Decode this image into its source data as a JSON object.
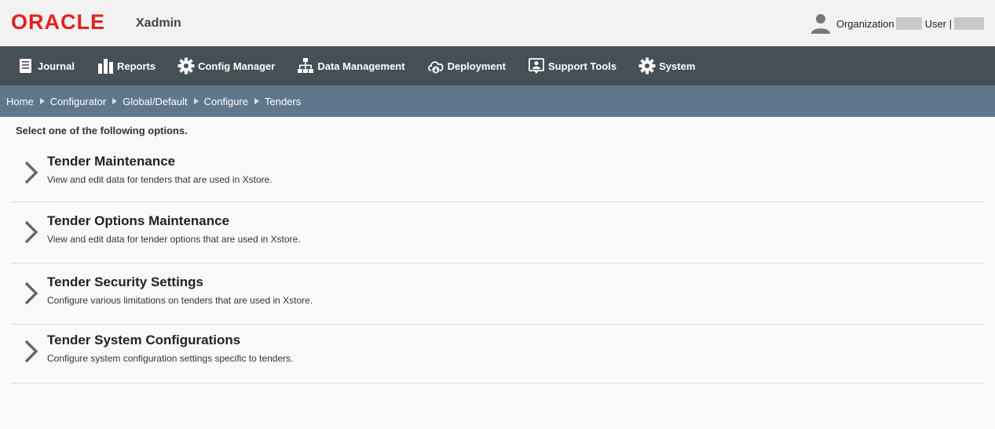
{
  "header": {
    "logo_text": "ORACLE",
    "app_name": "Xadmin",
    "org_label": "Organization",
    "user_label": "User |"
  },
  "nav": {
    "items": [
      {
        "label": "Journal",
        "icon": "journal-icon"
      },
      {
        "label": "Reports",
        "icon": "reports-icon"
      },
      {
        "label": "Config Manager",
        "icon": "gear-icon"
      },
      {
        "label": "Data Management",
        "icon": "hierarchy-icon"
      },
      {
        "label": "Deployment",
        "icon": "cloud-download-icon"
      },
      {
        "label": "Support Tools",
        "icon": "support-icon"
      },
      {
        "label": "System",
        "icon": "gear-icon"
      }
    ]
  },
  "breadcrumb": [
    "Home",
    "Configurator",
    "Global/Default",
    "Configure",
    "Tenders"
  ],
  "content": {
    "instruction": "Select one of the following options.",
    "options": [
      {
        "title": "Tender Maintenance",
        "desc": "View and edit data for tenders that are used in Xstore."
      },
      {
        "title": "Tender Options Maintenance",
        "desc": "View and edit data for tender options that are used in Xstore."
      },
      {
        "title": "Tender Security Settings",
        "desc": "Configure various limitations on tenders that are used in Xstore."
      },
      {
        "title": "Tender System Configurations",
        "desc": "Configure system configuration settings specific to tenders."
      }
    ]
  },
  "colors": {
    "oracle_red": "#e3211d",
    "nav_bg": "#444f56",
    "breadcrumb_bg": "#5f778d"
  }
}
